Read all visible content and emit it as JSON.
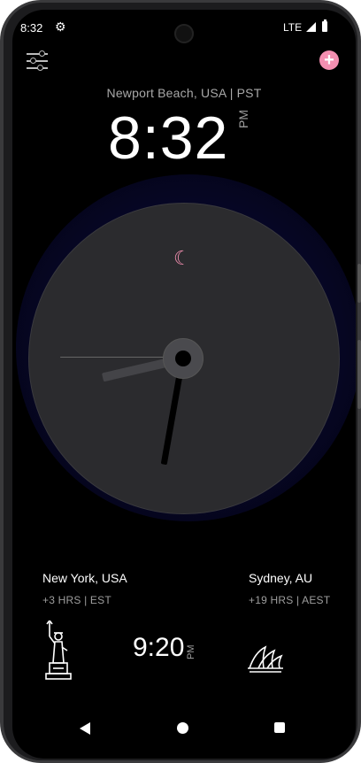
{
  "status_bar": {
    "time": "8:32",
    "network": "LTE"
  },
  "header": {
    "settings_icon": "sliders-icon",
    "add_icon": "plus-circle-icon",
    "add_glyph": "+"
  },
  "home_city": {
    "location": "Newport Beach, USA | PST",
    "time": "8:32",
    "ampm": "PM"
  },
  "analog_clock": {
    "hour": 8,
    "minute": 32,
    "moon_icon": "☾",
    "accent_color": "#f48fb1"
  },
  "world_clocks": {
    "left": {
      "city": "New York, USA",
      "offset": "+3 HRS | EST",
      "icon": "statue-of-liberty-icon"
    },
    "center": {
      "time": "9:20",
      "ampm": "PM"
    },
    "right": {
      "city": "Sydney, AU",
      "offset": "+19 HRS | AEST",
      "icon": "sydney-opera-house-icon"
    }
  },
  "nav_bar": {
    "back": "back-icon",
    "home": "home-icon",
    "recents": "recents-icon"
  }
}
